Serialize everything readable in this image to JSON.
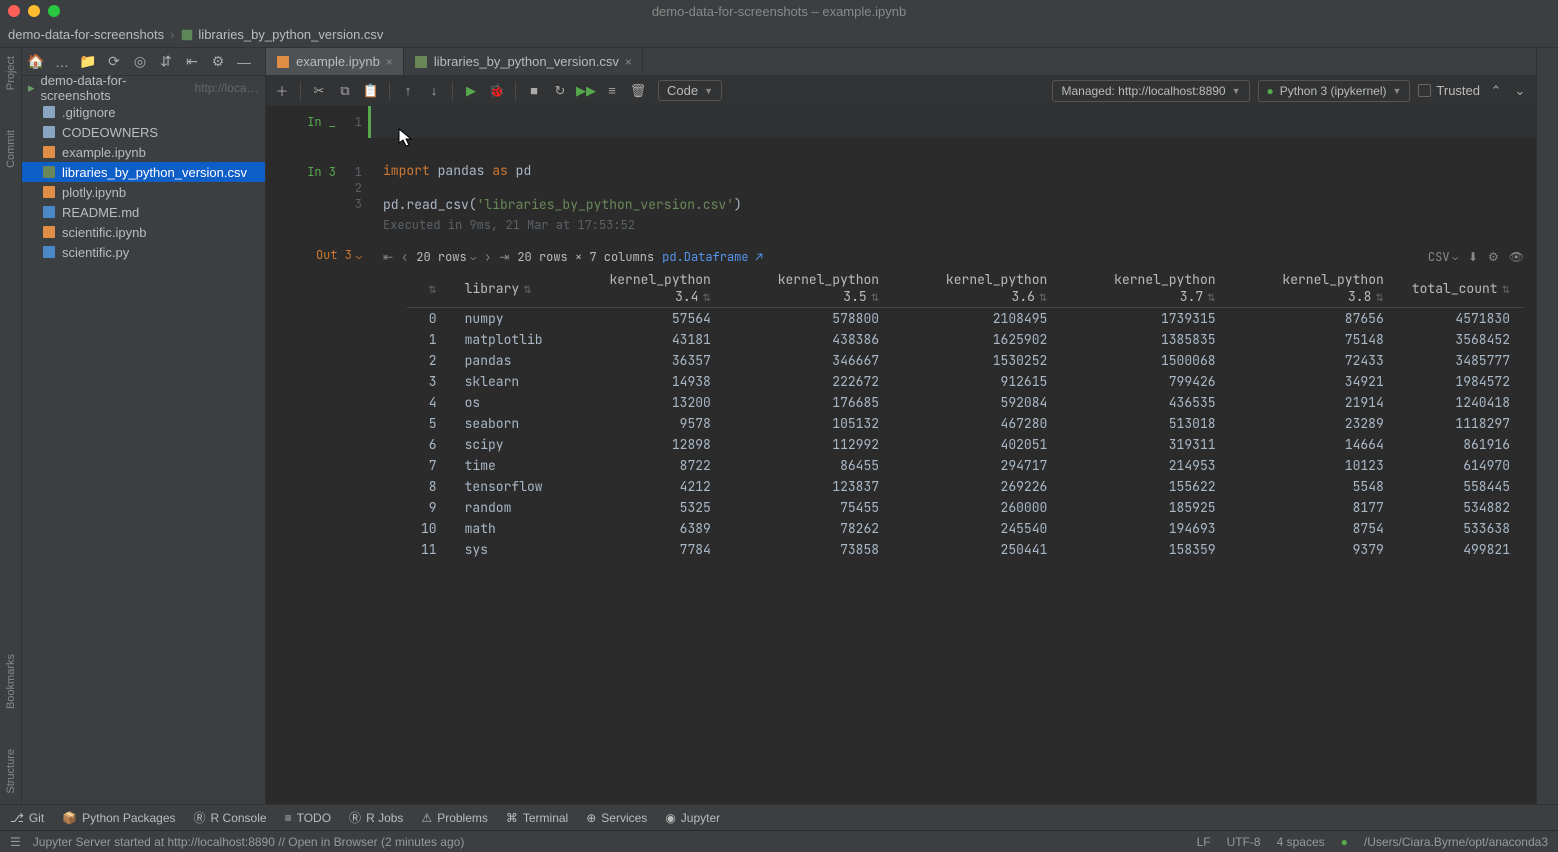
{
  "window": {
    "title": "demo-data-for-screenshots – example.ipynb"
  },
  "breadcrumbs": {
    "root": "demo-data-for-screenshots",
    "file": "libraries_by_python_version.csv"
  },
  "left_gutter": {
    "project": "Project",
    "commit": "Commit",
    "bookmarks": "Bookmarks",
    "structure": "Structure"
  },
  "sidebar": {
    "root": "demo-data-for-screenshots",
    "root_url": "http://localho",
    "files": [
      {
        "name": ".gitignore",
        "icon": "text"
      },
      {
        "name": "CODEOWNERS",
        "icon": "text"
      },
      {
        "name": "example.ipynb",
        "icon": "notebook"
      },
      {
        "name": "libraries_by_python_version.csv",
        "icon": "csv",
        "selected": true
      },
      {
        "name": "plotly.ipynb",
        "icon": "notebook"
      },
      {
        "name": "README.md",
        "icon": "md"
      },
      {
        "name": "scientific.ipynb",
        "icon": "notebook"
      },
      {
        "name": "scientific.py",
        "icon": "python"
      }
    ]
  },
  "editor_tabs": [
    {
      "label": "example.ipynb",
      "icon": "notebook",
      "active": true
    },
    {
      "label": "libraries_by_python_version.csv",
      "icon": "csv",
      "active": false
    }
  ],
  "notebook_toolbar": {
    "cell_type": "Code",
    "managed": "Managed: http://localhost:8890",
    "kernel": "Python 3 (ipykernel)",
    "trusted": "Trusted"
  },
  "cells": {
    "empty": {
      "in_label": "In _",
      "lineno": "1"
    },
    "code": {
      "in_label": "In 3",
      "lines": [
        {
          "n": "1",
          "html": "import pandas as pd"
        },
        {
          "n": "2",
          "html": ""
        },
        {
          "n": "3",
          "html": "pd.read_csv('libraries_by_python_version.csv')"
        }
      ],
      "exec_info": "Executed in 9ms, 21 Mar at 17:53:52"
    },
    "output": {
      "out_label": "Out 3",
      "rows_dropdown": "20 rows",
      "summary": "20 rows × 7 columns",
      "pd_link": "pd.Dataframe",
      "csv_label": "CSV",
      "columns": [
        "",
        "library",
        "kernel_python 3.4",
        "kernel_python 3.5",
        "kernel_python 3.6",
        "kernel_python 3.7",
        "kernel_python 3.8",
        "total_count"
      ],
      "data": [
        [
          0,
          "numpy",
          57564,
          578800,
          2108495,
          1739315,
          87656,
          4571830
        ],
        [
          1,
          "matplotlib",
          43181,
          438386,
          1625902,
          1385835,
          75148,
          3568452
        ],
        [
          2,
          "pandas",
          36357,
          346667,
          1530252,
          1500068,
          72433,
          3485777
        ],
        [
          3,
          "sklearn",
          14938,
          222672,
          912615,
          799426,
          34921,
          1984572
        ],
        [
          4,
          "os",
          13200,
          176685,
          592084,
          436535,
          21914,
          1240418
        ],
        [
          5,
          "seaborn",
          9578,
          105132,
          467280,
          513018,
          23289,
          1118297
        ],
        [
          6,
          "scipy",
          12898,
          112992,
          402051,
          319311,
          14664,
          861916
        ],
        [
          7,
          "time",
          8722,
          86455,
          294717,
          214953,
          10123,
          614970
        ],
        [
          8,
          "tensorflow",
          4212,
          123837,
          269226,
          155622,
          5548,
          558445
        ],
        [
          9,
          "random",
          5325,
          75455,
          260000,
          185925,
          8177,
          534882
        ],
        [
          10,
          "math",
          6389,
          78262,
          245540,
          194693,
          8754,
          533638
        ],
        [
          11,
          "sys",
          7784,
          73858,
          250441,
          158359,
          9379,
          499821
        ]
      ]
    }
  },
  "bottom_tools": {
    "git": "Git",
    "python_packages": "Python Packages",
    "r_console": "R Console",
    "todo": "TODO",
    "r_jobs": "R Jobs",
    "problems": "Problems",
    "terminal": "Terminal",
    "services": "Services",
    "jupyter": "Jupyter"
  },
  "status_bar": {
    "message": "Jupyter Server started at http://localhost:8890 // Open in Browser (2 minutes ago)",
    "lf": "LF",
    "encoding": "UTF-8",
    "indent": "4 spaces",
    "interpreter": "/Users/Ciara.Byrne/opt/anaconda3"
  }
}
